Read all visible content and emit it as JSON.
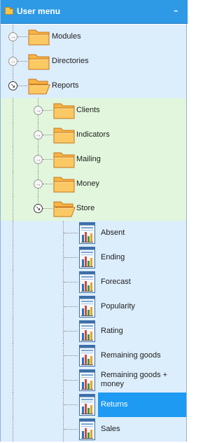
{
  "header": {
    "title": "User menu",
    "pin_glyph": "⌁"
  },
  "colors": {
    "title_bar": "#2e9ae6",
    "row_blue": "#dcedfc",
    "row_green": "#e1f6dc",
    "selection": "#1e9af2",
    "folder": "#f5a623"
  },
  "tree": [
    {
      "label": "Modules",
      "level": 0,
      "kind": "folder",
      "expanded": false,
      "selected": false,
      "icon": "folder-closed-icon"
    },
    {
      "label": "Directories",
      "level": 0,
      "kind": "folder",
      "expanded": false,
      "selected": false,
      "icon": "folder-closed-icon"
    },
    {
      "label": "Reports",
      "level": 0,
      "kind": "folder",
      "expanded": true,
      "selected": false,
      "icon": "folder-open-icon"
    },
    {
      "label": "Clients",
      "level": 1,
      "kind": "folder",
      "expanded": false,
      "selected": false,
      "icon": "folder-closed-icon"
    },
    {
      "label": "Indicators",
      "level": 1,
      "kind": "folder",
      "expanded": false,
      "selected": false,
      "icon": "folder-closed-icon"
    },
    {
      "label": "Mailing",
      "level": 1,
      "kind": "folder",
      "expanded": false,
      "selected": false,
      "icon": "folder-closed-icon"
    },
    {
      "label": "Money",
      "level": 1,
      "kind": "folder",
      "expanded": false,
      "selected": false,
      "icon": "folder-closed-icon"
    },
    {
      "label": "Store",
      "level": 1,
      "kind": "folder",
      "expanded": true,
      "selected": false,
      "icon": "folder-open-icon"
    },
    {
      "label": "Absent",
      "level": 2,
      "kind": "report",
      "selected": false,
      "icon": "report-icon"
    },
    {
      "label": "Ending",
      "level": 2,
      "kind": "report",
      "selected": false,
      "icon": "report-icon"
    },
    {
      "label": "Forecast",
      "level": 2,
      "kind": "report",
      "selected": false,
      "icon": "report-icon"
    },
    {
      "label": "Popularity",
      "level": 2,
      "kind": "report",
      "selected": false,
      "icon": "report-icon"
    },
    {
      "label": "Rating",
      "level": 2,
      "kind": "report",
      "selected": false,
      "icon": "report-icon"
    },
    {
      "label": "Remaining goods",
      "level": 2,
      "kind": "report",
      "selected": false,
      "icon": "report-icon"
    },
    {
      "label": "Remaining goods +\nmoney",
      "level": 2,
      "kind": "report",
      "selected": false,
      "icon": "report-icon"
    },
    {
      "label": "Returns",
      "level": 2,
      "kind": "report",
      "selected": true,
      "icon": "report-icon"
    },
    {
      "label": "Sales",
      "level": 2,
      "kind": "report",
      "selected": false,
      "icon": "report-icon"
    }
  ]
}
